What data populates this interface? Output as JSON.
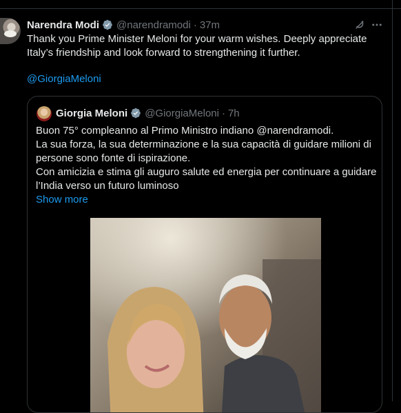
{
  "tweet": {
    "author_name": "Narendra Modi",
    "author_handle": "@narendramodi",
    "separator": "·",
    "time": "37m",
    "text": "Thank you Prime Minister Meloni for your warm wishes. Deeply appreciate Italy’s friendship and look forward to strengthening it further.",
    "mention": "@GiorgiaMeloni"
  },
  "quote": {
    "author_name": "Giorgia Meloni",
    "author_handle": "@GiorgiaMeloni",
    "separator": "·",
    "time": "7h",
    "lines": [
      "Buon 75° compleanno al Primo Ministro indiano @narendramodi.",
      "La sua forza, la sua determinazione e la sua capacità di guidare milioni di persone sono fonte di ispirazione.",
      "Con amicizia e stima gli auguro salute ed energia per continuare a guidare l’India verso un futuro luminoso"
    ],
    "show_more": "Show more"
  },
  "icons": {
    "verified": "verified-badge-icon",
    "grok": "grok-icon",
    "more": "more-options-icon"
  },
  "colors": {
    "background": "#000000",
    "text": "#e7e9ea",
    "muted": "#71767b",
    "link": "#1d9bf0",
    "border": "#2f3336"
  }
}
